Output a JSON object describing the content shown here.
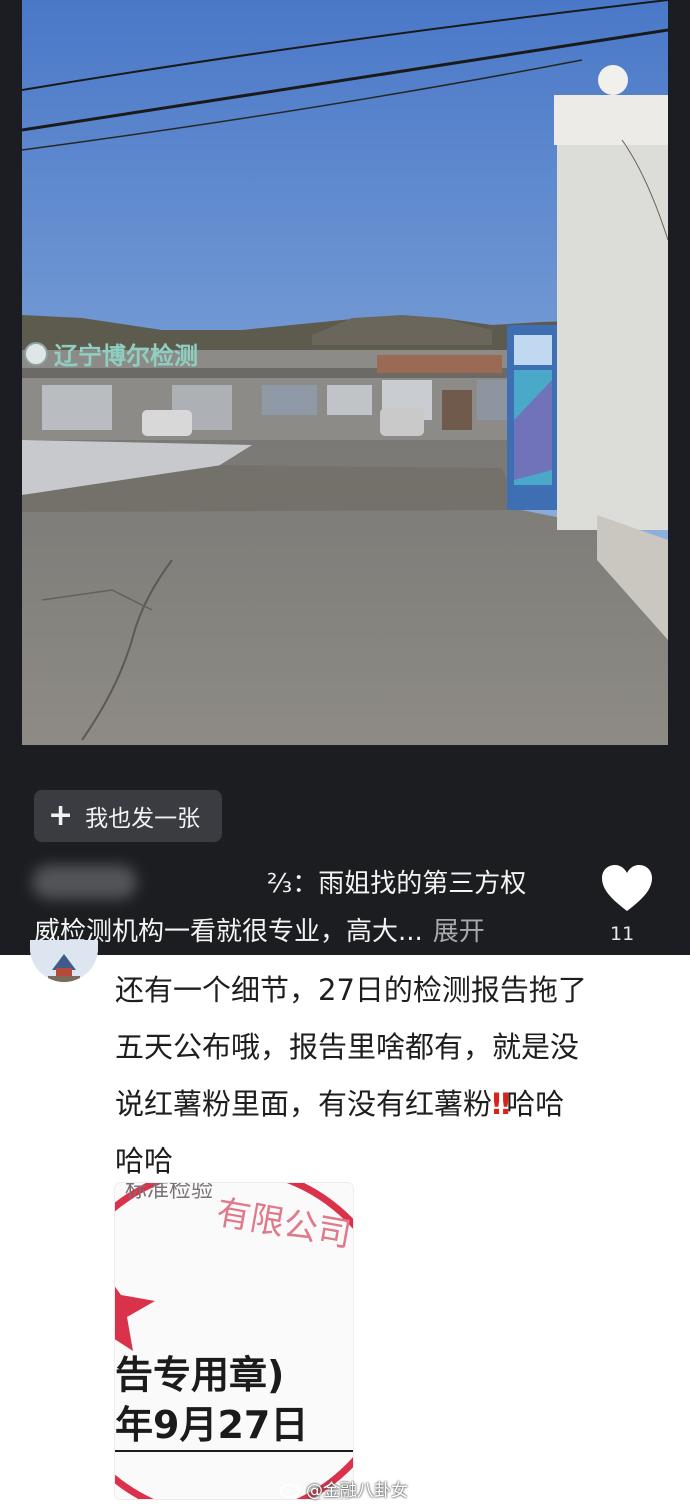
{
  "overlay": {
    "post_button_label": "我也发一张",
    "caption_line1": "⅔：雨姐找的第三方权",
    "caption_line2": "威检测机构一看就很专业，高大...",
    "expand_label": "展开",
    "like_count": "11",
    "sign_text": "辽宁博尔检测"
  },
  "comment": {
    "lines": [
      "还有一个细节，27日的检测报告拖了",
      "五天公布哦，报告里啥都有，就是没",
      "说红薯粉里面，有没有红薯粉",
      "哈哈"
    ],
    "line3_suffix": "哈哈",
    "emoji": "‼"
  },
  "stamp_image": {
    "line1": "告专用章)",
    "line2": "年9月27日",
    "top_text": "标准检验",
    "ring_text": "有限公司"
  },
  "watermark": {
    "text": "@金融八卦女"
  },
  "colors": {
    "panel_bg": "#1c1d21",
    "button_bg": "#3b3c42",
    "stamp_red": "#d9324a",
    "emoji_red": "#d9241c"
  }
}
